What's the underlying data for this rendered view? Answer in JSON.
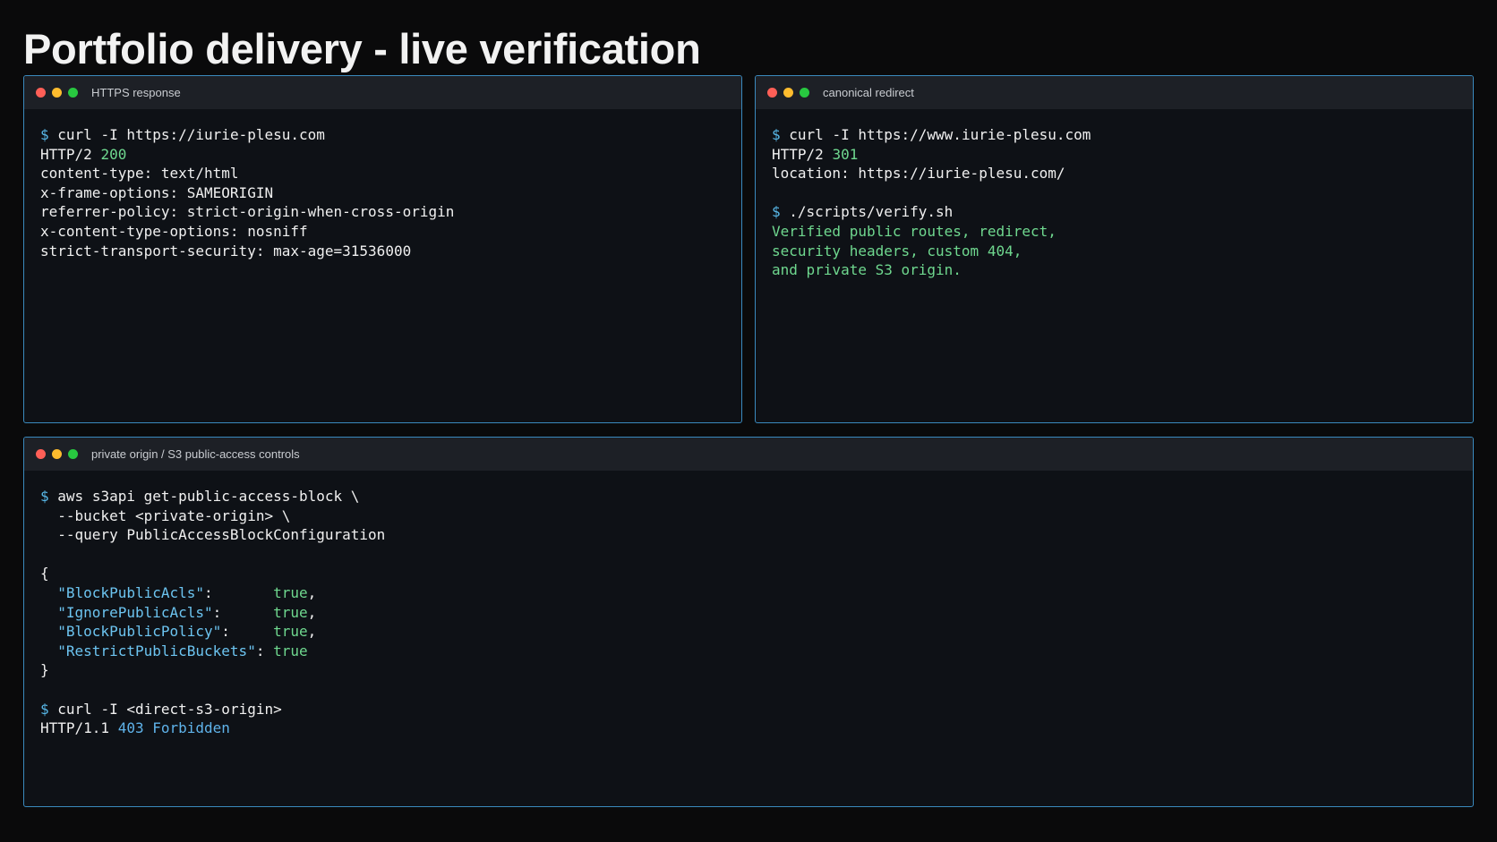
{
  "title": "Portfolio delivery - live verification",
  "colors": {
    "accent_border": "#3a89bd",
    "prompt": "#58b8e8",
    "success": "#6fd88f",
    "json_key": "#6cc4f0",
    "forbidden": "#5fb3ea"
  },
  "window_controls": [
    "close-dot-red",
    "minimize-dot-yellow",
    "zoom-dot-green"
  ],
  "terminals": {
    "https": {
      "title": "HTTPS response",
      "prompt_symbol": "$",
      "command": "curl -I https://iurie-plesu.com",
      "status_prefix": "HTTP/2",
      "status_code": "200",
      "headers": [
        "content-type: text/html",
        "x-frame-options: SAMEORIGIN",
        "referrer-policy: strict-origin-when-cross-origin",
        "x-content-type-options: nosniff",
        "strict-transport-security: max-age=31536000"
      ]
    },
    "redirect": {
      "title": "canonical redirect",
      "prompt_symbol": "$",
      "command": "curl -I https://www.iurie-plesu.com",
      "status_prefix": "HTTP/2",
      "status_code": "301",
      "location": "location: https://iurie-plesu.com/",
      "verify_command": "./scripts/verify.sh",
      "verify_output": [
        "Verified public routes, redirect,",
        "security headers, custom 404,",
        "and private S3 origin."
      ]
    },
    "s3": {
      "title": "private origin / S3 public-access controls",
      "prompt_symbol": "$",
      "command": "aws s3api get-public-access-block \\",
      "command_cont": [
        "  --bucket <private-origin> \\",
        "  --query PublicAccessBlockConfiguration"
      ],
      "json_open": "{",
      "entries": [
        {
          "key": "\"BlockPublicAcls\"",
          "colon": ":       ",
          "value": "true",
          "trail": ","
        },
        {
          "key": "\"IgnorePublicAcls\"",
          "colon": ":      ",
          "value": "true",
          "trail": ","
        },
        {
          "key": "\"BlockPublicPolicy\"",
          "colon": ":     ",
          "value": "true",
          "trail": ","
        },
        {
          "key": "\"RestrictPublicBuckets\"",
          "colon": ": ",
          "value": "true",
          "trail": ""
        }
      ],
      "json_close": "}",
      "command2": "curl -I <direct-s3-origin>",
      "status2_prefix": "HTTP/1.1",
      "status2_code": "403 Forbidden"
    }
  }
}
